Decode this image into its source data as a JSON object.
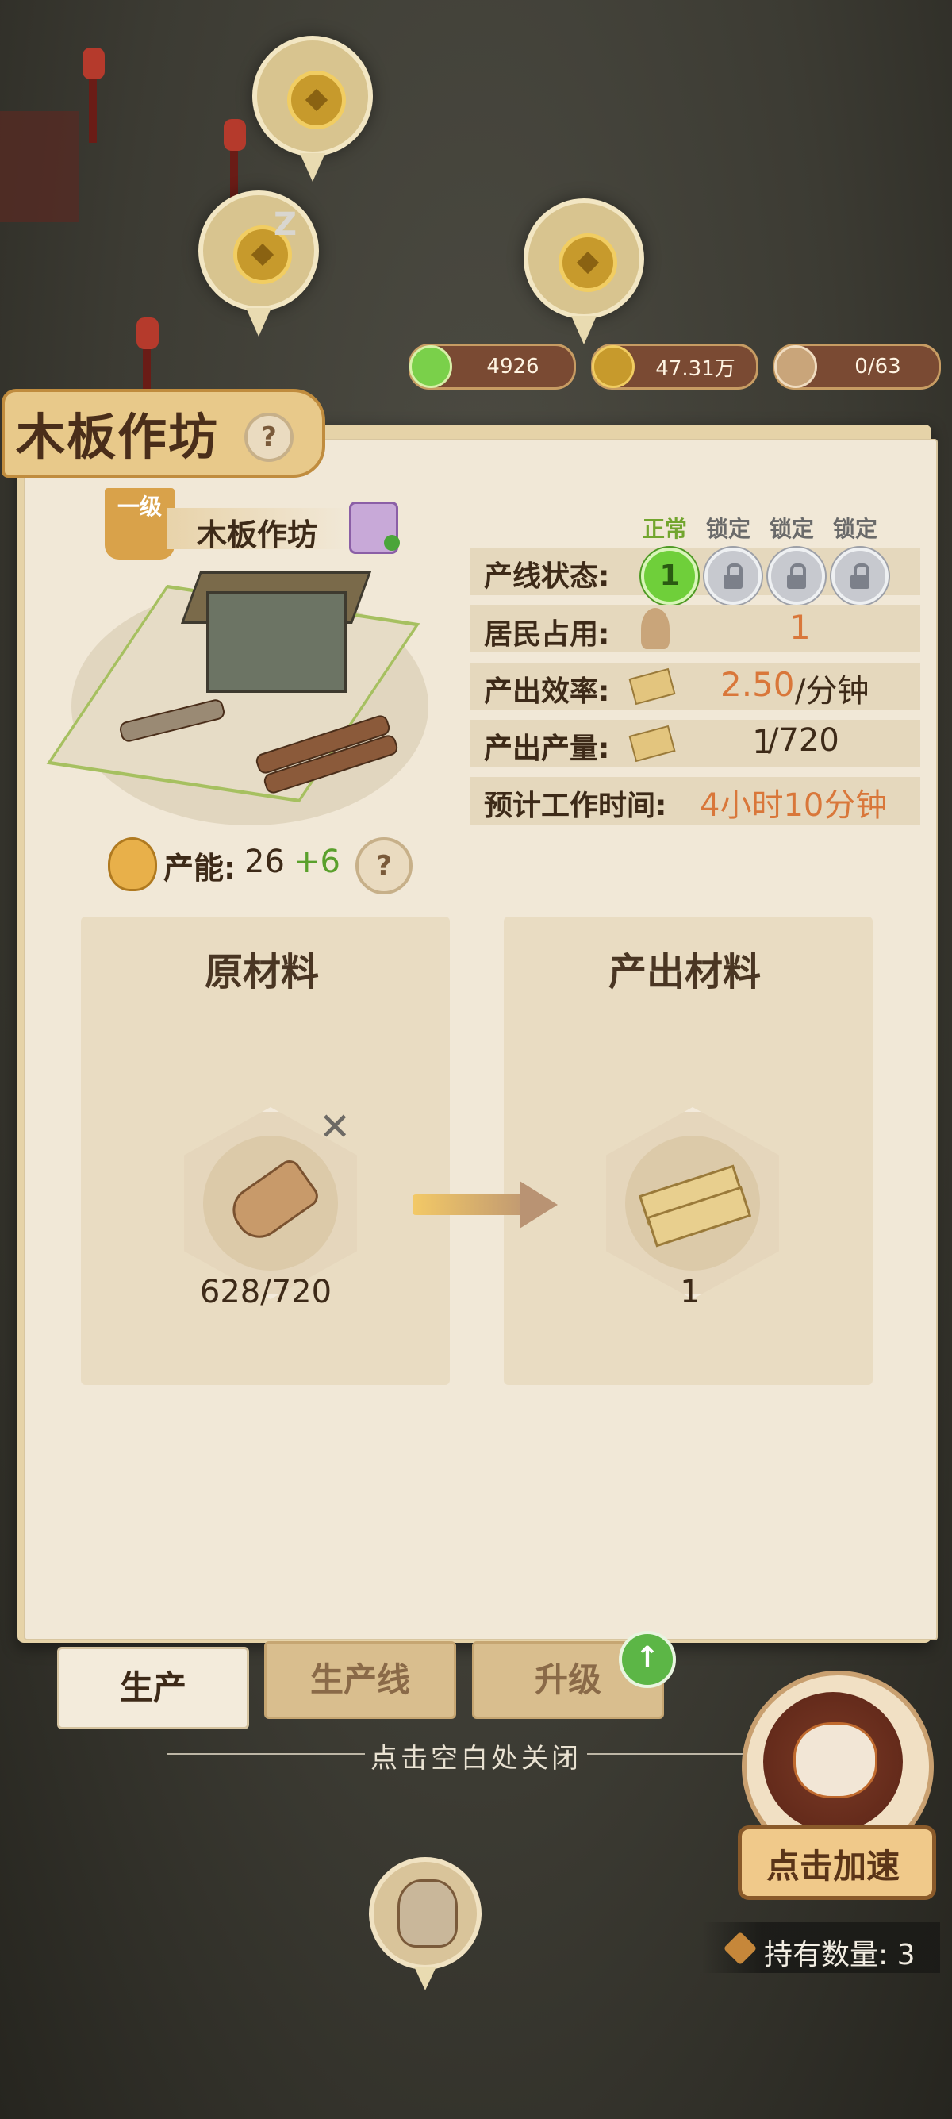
{
  "resources": [
    {
      "icon": "jade-coin-icon",
      "value": "4926"
    },
    {
      "icon": "copper-coin-icon",
      "value": "47.31万"
    },
    {
      "icon": "worker-icon",
      "value": "0/63"
    }
  ],
  "building": {
    "title": "木板作坊",
    "level_label": "一级",
    "name": "木板作坊",
    "capacity_label": "产能:",
    "capacity_value": "26",
    "capacity_bonus": "+6"
  },
  "status": {
    "slot_headers": [
      "正常",
      "锁定",
      "锁定",
      "锁定"
    ],
    "active_slot_value": "1",
    "line_status_label": "产线状态:",
    "residents_label": "居民占用:",
    "residents_value": "1",
    "efficiency_label": "产出效率:",
    "efficiency_value": "2.50",
    "efficiency_unit": "/分钟",
    "output_label": "产出产量:",
    "output_current": "1",
    "output_total": "/720",
    "time_label": "预计工作时间:",
    "time_value": "4小时10分钟"
  },
  "materials": {
    "input_title": "原材料",
    "output_title": "产出材料",
    "input_count": "628/720",
    "output_count": "1",
    "remove_symbol": "✕"
  },
  "tabs": [
    {
      "label": "生产",
      "active": true
    },
    {
      "label": "生产线",
      "active": false
    },
    {
      "label": "升级",
      "active": false
    }
  ],
  "close_hint": "点击空白处关闭",
  "speed_button": "点击加速",
  "hold_count": "持有数量: 3",
  "colors": {
    "accent_orange": "#d9773a",
    "accent_green": "#5aa02c",
    "header_green": "#72a52e",
    "header_gray": "#6a6a6a"
  }
}
